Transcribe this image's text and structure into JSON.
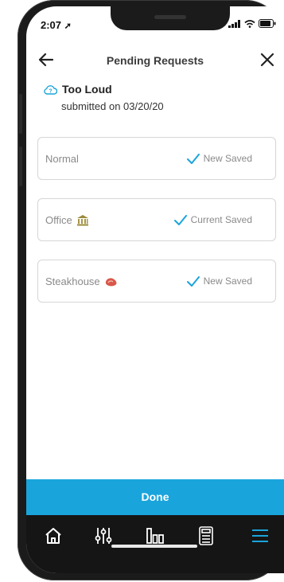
{
  "status_bar": {
    "time": "2:07"
  },
  "header": {
    "title": "Pending Requests"
  },
  "request": {
    "title": "Too Loud",
    "submitted": "submitted on 03/20/20"
  },
  "cards": [
    {
      "name": "Normal",
      "status": "New Saved",
      "icon": "none"
    },
    {
      "name": "Office",
      "status": "Current Saved",
      "icon": "building-icon"
    },
    {
      "name": "Steakhouse",
      "status": "New Saved",
      "icon": "steak-icon"
    }
  ],
  "done_label": "Done",
  "tabbar": {
    "items": [
      "home-icon",
      "equalizer-icon",
      "bar-chart-icon",
      "calculator-icon",
      "menu-icon"
    ],
    "active": "menu-icon"
  },
  "colors": {
    "accent": "#1aa4dc",
    "tabbar": "#151515",
    "text_muted": "#8a8a8a"
  }
}
